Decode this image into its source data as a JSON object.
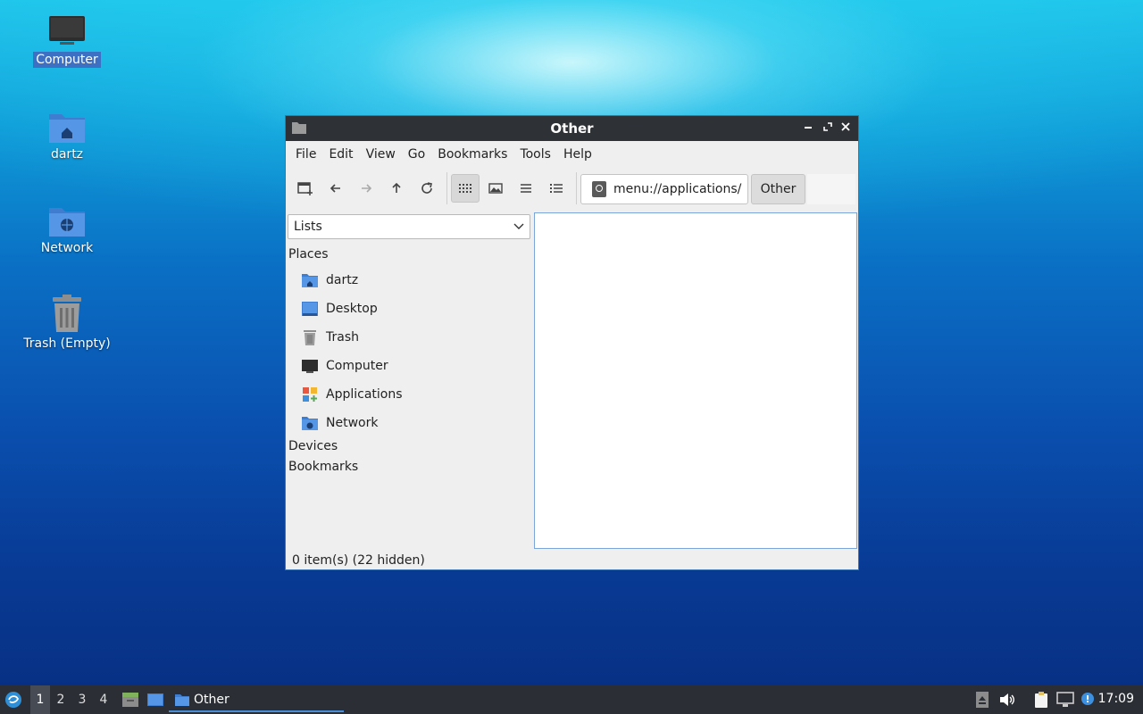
{
  "desktop": {
    "icons": [
      {
        "label": "Computer",
        "icon": "computer-icon"
      },
      {
        "label": "dartz",
        "icon": "home-folder-icon"
      },
      {
        "label": "Network",
        "icon": "network-folder-icon"
      },
      {
        "label": "Trash (Empty)",
        "icon": "trash-icon"
      }
    ]
  },
  "window": {
    "title": "Other",
    "menu": [
      "File",
      "Edit",
      "View",
      "Go",
      "Bookmarks",
      "Tools",
      "Help"
    ],
    "toolbar": {
      "location": "menu://applications/",
      "path_button": "Other"
    },
    "sidebar": {
      "selector": "Lists",
      "places_heading": "Places",
      "places": [
        {
          "label": "dartz",
          "icon": "home-folder-icon"
        },
        {
          "label": "Desktop",
          "icon": "desktop-icon"
        },
        {
          "label": "Trash",
          "icon": "trash-icon"
        },
        {
          "label": "Computer",
          "icon": "computer-icon"
        },
        {
          "label": "Applications",
          "icon": "applications-icon"
        },
        {
          "label": "Network",
          "icon": "network-folder-icon"
        }
      ],
      "devices_heading": "Devices",
      "bookmarks_heading": "Bookmarks"
    },
    "status": "0 item(s) (22 hidden)"
  },
  "taskbar": {
    "workspaces": [
      "1",
      "2",
      "3",
      "4"
    ],
    "task_label": "Other",
    "clock": "17:09"
  },
  "colors": {
    "accent": "#3d6fc2",
    "titlebar": "#2e3136",
    "taskbar": "#2b2f35"
  }
}
